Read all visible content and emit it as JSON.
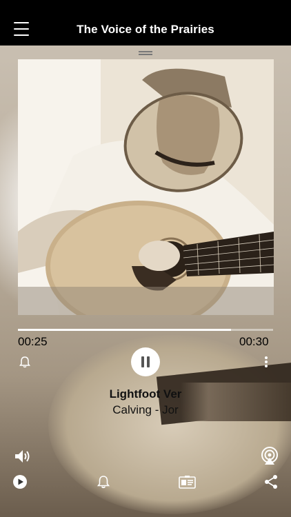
{
  "header": {
    "title": "The Voice of the Prairies"
  },
  "player": {
    "elapsed": "00:25",
    "total": "00:30",
    "progress": 0.834,
    "track_title": "Lightfoot Ver",
    "track_artist": "Calving - Jor",
    "state": "playing"
  },
  "icons": {
    "menu": "hamburger-menu-icon",
    "alarm": "bell-icon",
    "pause": "pause-icon",
    "more": "more-vertical-icon",
    "volume": "speaker-icon",
    "airplay": "airplay-icon",
    "play": "play-circle-icon",
    "notifications": "bell-icon",
    "contact": "contact-card-icon",
    "share": "share-icon"
  },
  "colors": {
    "header_bg": "#000000",
    "accent": "#ffffff"
  }
}
